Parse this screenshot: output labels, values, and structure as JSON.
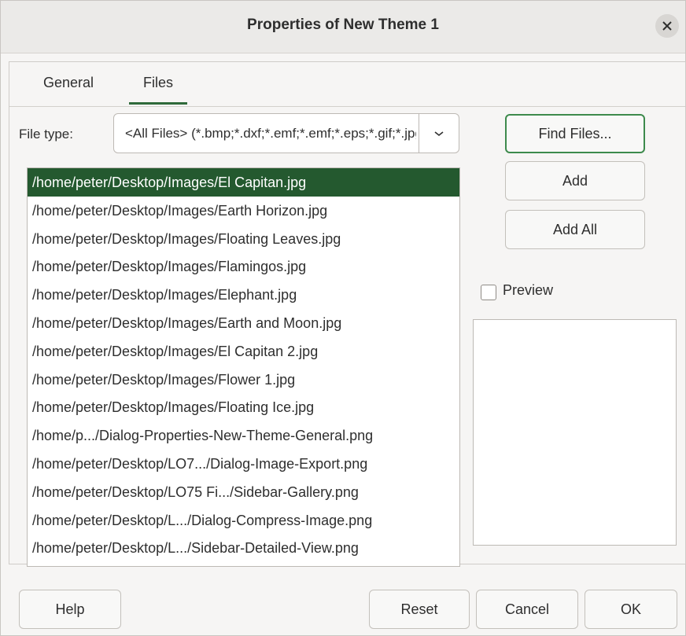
{
  "window": {
    "title": "Properties of New Theme 1",
    "close_icon": "close-icon"
  },
  "tabs": [
    {
      "label": "General",
      "active": false
    },
    {
      "label": "Files",
      "active": true
    }
  ],
  "file_type": {
    "label": "File type:",
    "value": "<All Files> (*.bmp;*.dxf;*.emf;*.emf;*.eps;*.gif;*.jpg",
    "dropdown_icon": "chevron-down-icon"
  },
  "files": [
    "/home/peter/Desktop/Images/El Capitan.jpg",
    "/home/peter/Desktop/Images/Earth Horizon.jpg",
    "/home/peter/Desktop/Images/Floating Leaves.jpg",
    "/home/peter/Desktop/Images/Flamingos.jpg",
    "/home/peter/Desktop/Images/Elephant.jpg",
    "/home/peter/Desktop/Images/Earth and Moon.jpg",
    "/home/peter/Desktop/Images/El Capitan 2.jpg",
    "/home/peter/Desktop/Images/Flower 1.jpg",
    "/home/peter/Desktop/Images/Floating Ice.jpg",
    "/home/p.../Dialog-Properties-New-Theme-General.png",
    "/home/peter/Desktop/LO7.../Dialog-Image-Export.png",
    "/home/peter/Desktop/LO75 Fi.../Sidebar-Gallery.png",
    "/home/peter/Desktop/L.../Dialog-Compress-Image.png",
    "/home/peter/Desktop/L.../Sidebar-Detailed-View.png"
  ],
  "selected_index": 0,
  "buttons": {
    "find_files": "Find Files...",
    "add": "Add",
    "add_all": "Add All",
    "help": "Help",
    "reset": "Reset",
    "cancel": "Cancel",
    "ok": "OK"
  },
  "preview": {
    "label": "Preview",
    "checked": false
  },
  "colors": {
    "accent": "#24592f",
    "focus_border": "#3d8a4c"
  }
}
